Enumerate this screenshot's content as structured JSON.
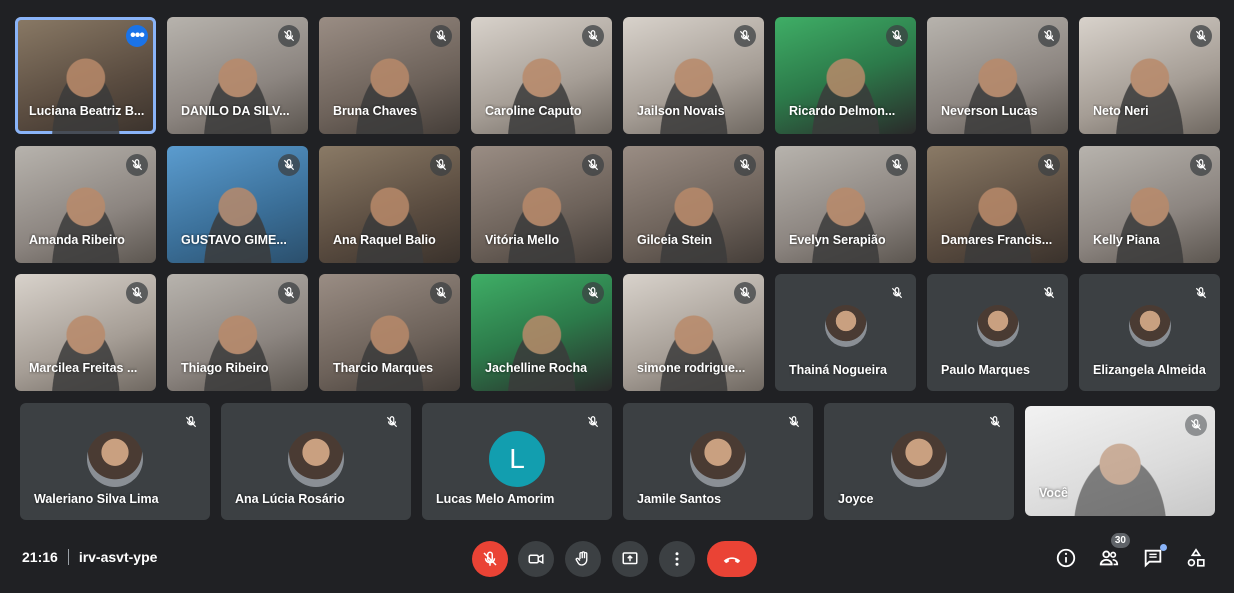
{
  "participants": {
    "row1": [
      {
        "name": "Luciana Beatriz B..."
      },
      {
        "name": "DANILO DA SILV..."
      },
      {
        "name": "Bruna Chaves"
      },
      {
        "name": "Caroline Caputo"
      },
      {
        "name": "Jailson Novais"
      },
      {
        "name": "Ricardo Delmon..."
      },
      {
        "name": "Neverson Lucas"
      },
      {
        "name": "Neto Neri"
      }
    ],
    "row2": [
      {
        "name": "Amanda Ribeiro"
      },
      {
        "name": "GUSTAVO GIME..."
      },
      {
        "name": "Ana Raquel Balio"
      },
      {
        "name": "Vitória Mello"
      },
      {
        "name": "Gilceia Stein"
      },
      {
        "name": "Evelyn Serapião"
      },
      {
        "name": "Damares Francis..."
      },
      {
        "name": "Kelly Piana"
      }
    ],
    "row3": [
      {
        "name": "Marcilea Freitas ..."
      },
      {
        "name": "Thiago Ribeiro"
      },
      {
        "name": "Tharcio Marques"
      },
      {
        "name": "Jachelline Rocha"
      },
      {
        "name": "simone rodrigue..."
      },
      {
        "name": "Thainá Nogueira"
      },
      {
        "name": "Paulo Marques"
      },
      {
        "name": "Elizangela Almeida"
      }
    ],
    "row4": [
      {
        "name": "Waleriano Silva Lima"
      },
      {
        "name": "Ana Lúcia Rosário"
      },
      {
        "name": "Lucas Melo Amorim",
        "initial": "L"
      },
      {
        "name": "Jamile Santos"
      },
      {
        "name": "Joyce"
      },
      {
        "name": "Você"
      }
    ]
  },
  "meeting": {
    "time": "21:16",
    "code": "irv-asvt-ype",
    "participant_count": "30"
  },
  "colors": {
    "background": "#202124",
    "tile": "#3c4043",
    "accent": "#1a73e8",
    "danger": "#ea4335"
  },
  "icons": {
    "tile_muted": "mic-off-icon",
    "tile_options": "more-options-icon",
    "controls": [
      "mic-off-icon",
      "camera-icon",
      "raise-hand-icon",
      "present-screen-icon",
      "more-vert-icon",
      "end-call-icon"
    ],
    "right": [
      "info-icon",
      "people-icon",
      "chat-icon",
      "activities-icon"
    ]
  }
}
